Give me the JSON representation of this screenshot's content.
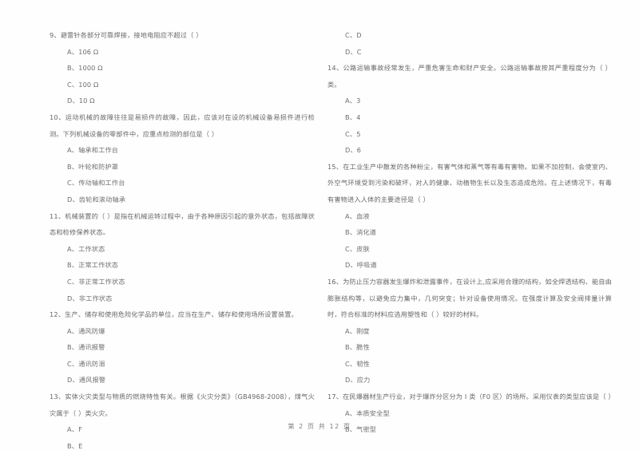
{
  "document": {
    "type": "scanned-exam-page",
    "language": "zh-CN",
    "background_color": "#ffffff",
    "text_color": "#5a5c61"
  },
  "footer": {
    "page_label": "第 2 页 共 12 页"
  },
  "left_column": {
    "items": [
      {
        "kind": "question",
        "number": "9",
        "text": "9、避雷针各部分可靠焊接，接地电阻应不超过（      ）"
      },
      {
        "kind": "option",
        "text": "A、106 Ω"
      },
      {
        "kind": "option",
        "text": "B、1000 Ω"
      },
      {
        "kind": "option",
        "text": "C、100 Ω"
      },
      {
        "kind": "option",
        "text": "D、10 Ω"
      },
      {
        "kind": "question",
        "number": "10",
        "text": "10、运动机械的故障往往是易损件的故障，因此，应该对在设的机械设备易损件进行检测。下列机械设备的零部件中，应重点检测的部位是（      ）"
      },
      {
        "kind": "option",
        "text": "A、轴承和工作台"
      },
      {
        "kind": "option",
        "text": "B、叶轮和防护罩"
      },
      {
        "kind": "option",
        "text": "C、传动轴和工作台"
      },
      {
        "kind": "option",
        "text": "D、齿轮和滚动轴承"
      },
      {
        "kind": "question",
        "number": "11",
        "text": "11、机械装置的（      ）是指在机械运转过程中，由于各种原因引起的意外状态，包括故障状态和检修保养状态。"
      },
      {
        "kind": "option",
        "text": "A、工作状态"
      },
      {
        "kind": "option",
        "text": "B、正常工作状态"
      },
      {
        "kind": "option",
        "text": "C、非正常工作状态"
      },
      {
        "kind": "option",
        "text": "D、非工作状态"
      },
      {
        "kind": "question",
        "number": "12",
        "text": "12、生产、储存和使用危险化学品的单位，应当在生产、储存和使用场所设置装置。"
      },
      {
        "kind": "option",
        "text": "A、通风防爆"
      },
      {
        "kind": "option",
        "text": "B、通讯报警"
      },
      {
        "kind": "option",
        "text": "C、通讯防溺"
      },
      {
        "kind": "option",
        "text": "D、通风报警"
      },
      {
        "kind": "question",
        "number": "13",
        "text": "13、实体火灾类型与物质的燃烧特性有关。根据《火灾分类》（GB4968-2008），煤气火灾属于（      ）类火灾。"
      },
      {
        "kind": "option",
        "text": "A、F"
      },
      {
        "kind": "option",
        "text": "B、E"
      }
    ]
  },
  "right_column": {
    "items": [
      {
        "kind": "option",
        "text": "C、D"
      },
      {
        "kind": "option",
        "text": "D、C"
      },
      {
        "kind": "question",
        "number": "14",
        "text": "14、公路运输事故经常发生，严重危害生命和财产安全。公路运输事故按其严重程度分为（      ）类。"
      },
      {
        "kind": "option",
        "text": "A、3"
      },
      {
        "kind": "option",
        "text": "B、4"
      },
      {
        "kind": "option",
        "text": "C、5"
      },
      {
        "kind": "option",
        "text": "D、6"
      },
      {
        "kind": "question",
        "number": "15",
        "text": "15、在工业生产中散发的各种粉尘，有害气体和蒸气等有毒有害物。如果不加控制，会使室内、外空气环境受到污染和破坏，对人的健康、动植物生长以及生态造成危险。在上述情况下，有毒有害物进入人体的主要途径是（      ）"
      },
      {
        "kind": "option",
        "text": "A、血液"
      },
      {
        "kind": "option",
        "text": "B、消化道"
      },
      {
        "kind": "option",
        "text": "C、皮肤"
      },
      {
        "kind": "option",
        "text": "D、呼吸道"
      },
      {
        "kind": "question",
        "number": "16",
        "text": "16、为防止压力容器发生爆炸和泄露事件，在设计上,应采用合理的结构，如全焊透结构、能自由膨胀结构等，以避免应力集中，几何突变；针对设备使用情况。在强度计算及安全阀排量计算时，符合标准的材料应选用塑性和（      ）较好的材料。"
      },
      {
        "kind": "option",
        "text": "A、刚度"
      },
      {
        "kind": "option",
        "text": "B、脆性"
      },
      {
        "kind": "option",
        "text": "C、韧性"
      },
      {
        "kind": "option",
        "text": "D、应力"
      },
      {
        "kind": "question",
        "number": "17",
        "text": "17、在民爆器材生产行业，对于爆炸分区分为 I 类（F0 区）的场所。采用仪表的类型应该是（      ）"
      },
      {
        "kind": "option",
        "text": "A、本质安全型"
      },
      {
        "kind": "option",
        "text": "B、气密型"
      }
    ]
  }
}
